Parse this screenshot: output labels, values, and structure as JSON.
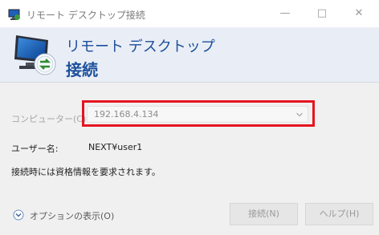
{
  "window": {
    "title": "リモート デスクトップ接続",
    "controls": {
      "minimize": "—",
      "maximize": "□",
      "close": "✕"
    }
  },
  "banner": {
    "line1": "リモート デスクトップ",
    "line2": "接続"
  },
  "form": {
    "computer_label": "コンピューター(C):",
    "computer_value": "192.168.4.134",
    "user_label": "ユーザー名:",
    "user_value": "NEXT¥user1",
    "credential_note": "接続時には資格情報を要求されます。"
  },
  "options_toggle": {
    "label": "オプションの表示(O)"
  },
  "buttons": {
    "connect": "接続(N)",
    "help": "ヘルプ(H)"
  },
  "colors": {
    "highlight_border": "#e5141f",
    "banner_text": "#1c4f9c"
  }
}
